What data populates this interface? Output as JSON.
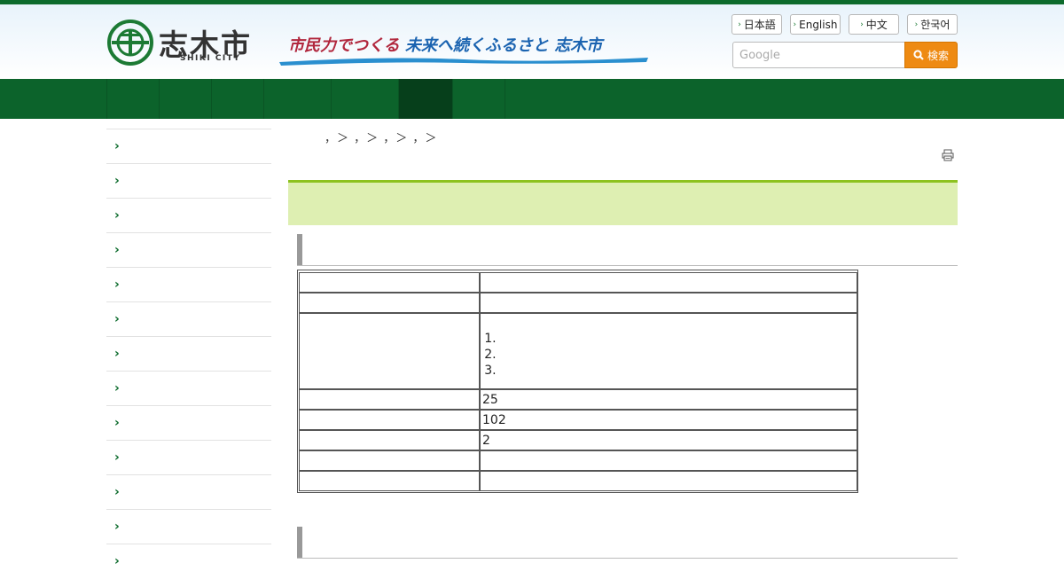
{
  "header": {
    "logo_text": "志木市",
    "logo_sub": "SHIKI CITY",
    "slogan_first": "市民力でつくる",
    "slogan_rest": "未来へ続くふるさと 志木市"
  },
  "languages": [
    {
      "label": "日本語"
    },
    {
      "label": "English"
    },
    {
      "label": "中文"
    },
    {
      "label": "한국어"
    }
  ],
  "search": {
    "placeholder": "Google",
    "button_label": "検索"
  },
  "nav": {
    "item_count": 8,
    "active_index": 6
  },
  "sidebar": {
    "item_count": 12
  },
  "breadcrumb": {
    "text": "，＞ ，＞ ，＞ ，＞"
  },
  "table": {
    "rows": [
      {
        "label": "",
        "value": ""
      },
      {
        "label": "",
        "value": ""
      },
      {
        "label": "",
        "list": [
          "",
          "",
          ""
        ]
      },
      {
        "label": "",
        "value": "25"
      },
      {
        "label": "",
        "value": "102"
      },
      {
        "label": "",
        "value": "2"
      },
      {
        "label": "",
        "value": ""
      },
      {
        "label": "",
        "value": ""
      }
    ]
  },
  "colors": {
    "brand_green": "#0c632b",
    "nav_active": "#063f1b",
    "title_band": "#deefb2",
    "title_band_border": "#8dc21f",
    "search_button": "#ee8a12"
  }
}
